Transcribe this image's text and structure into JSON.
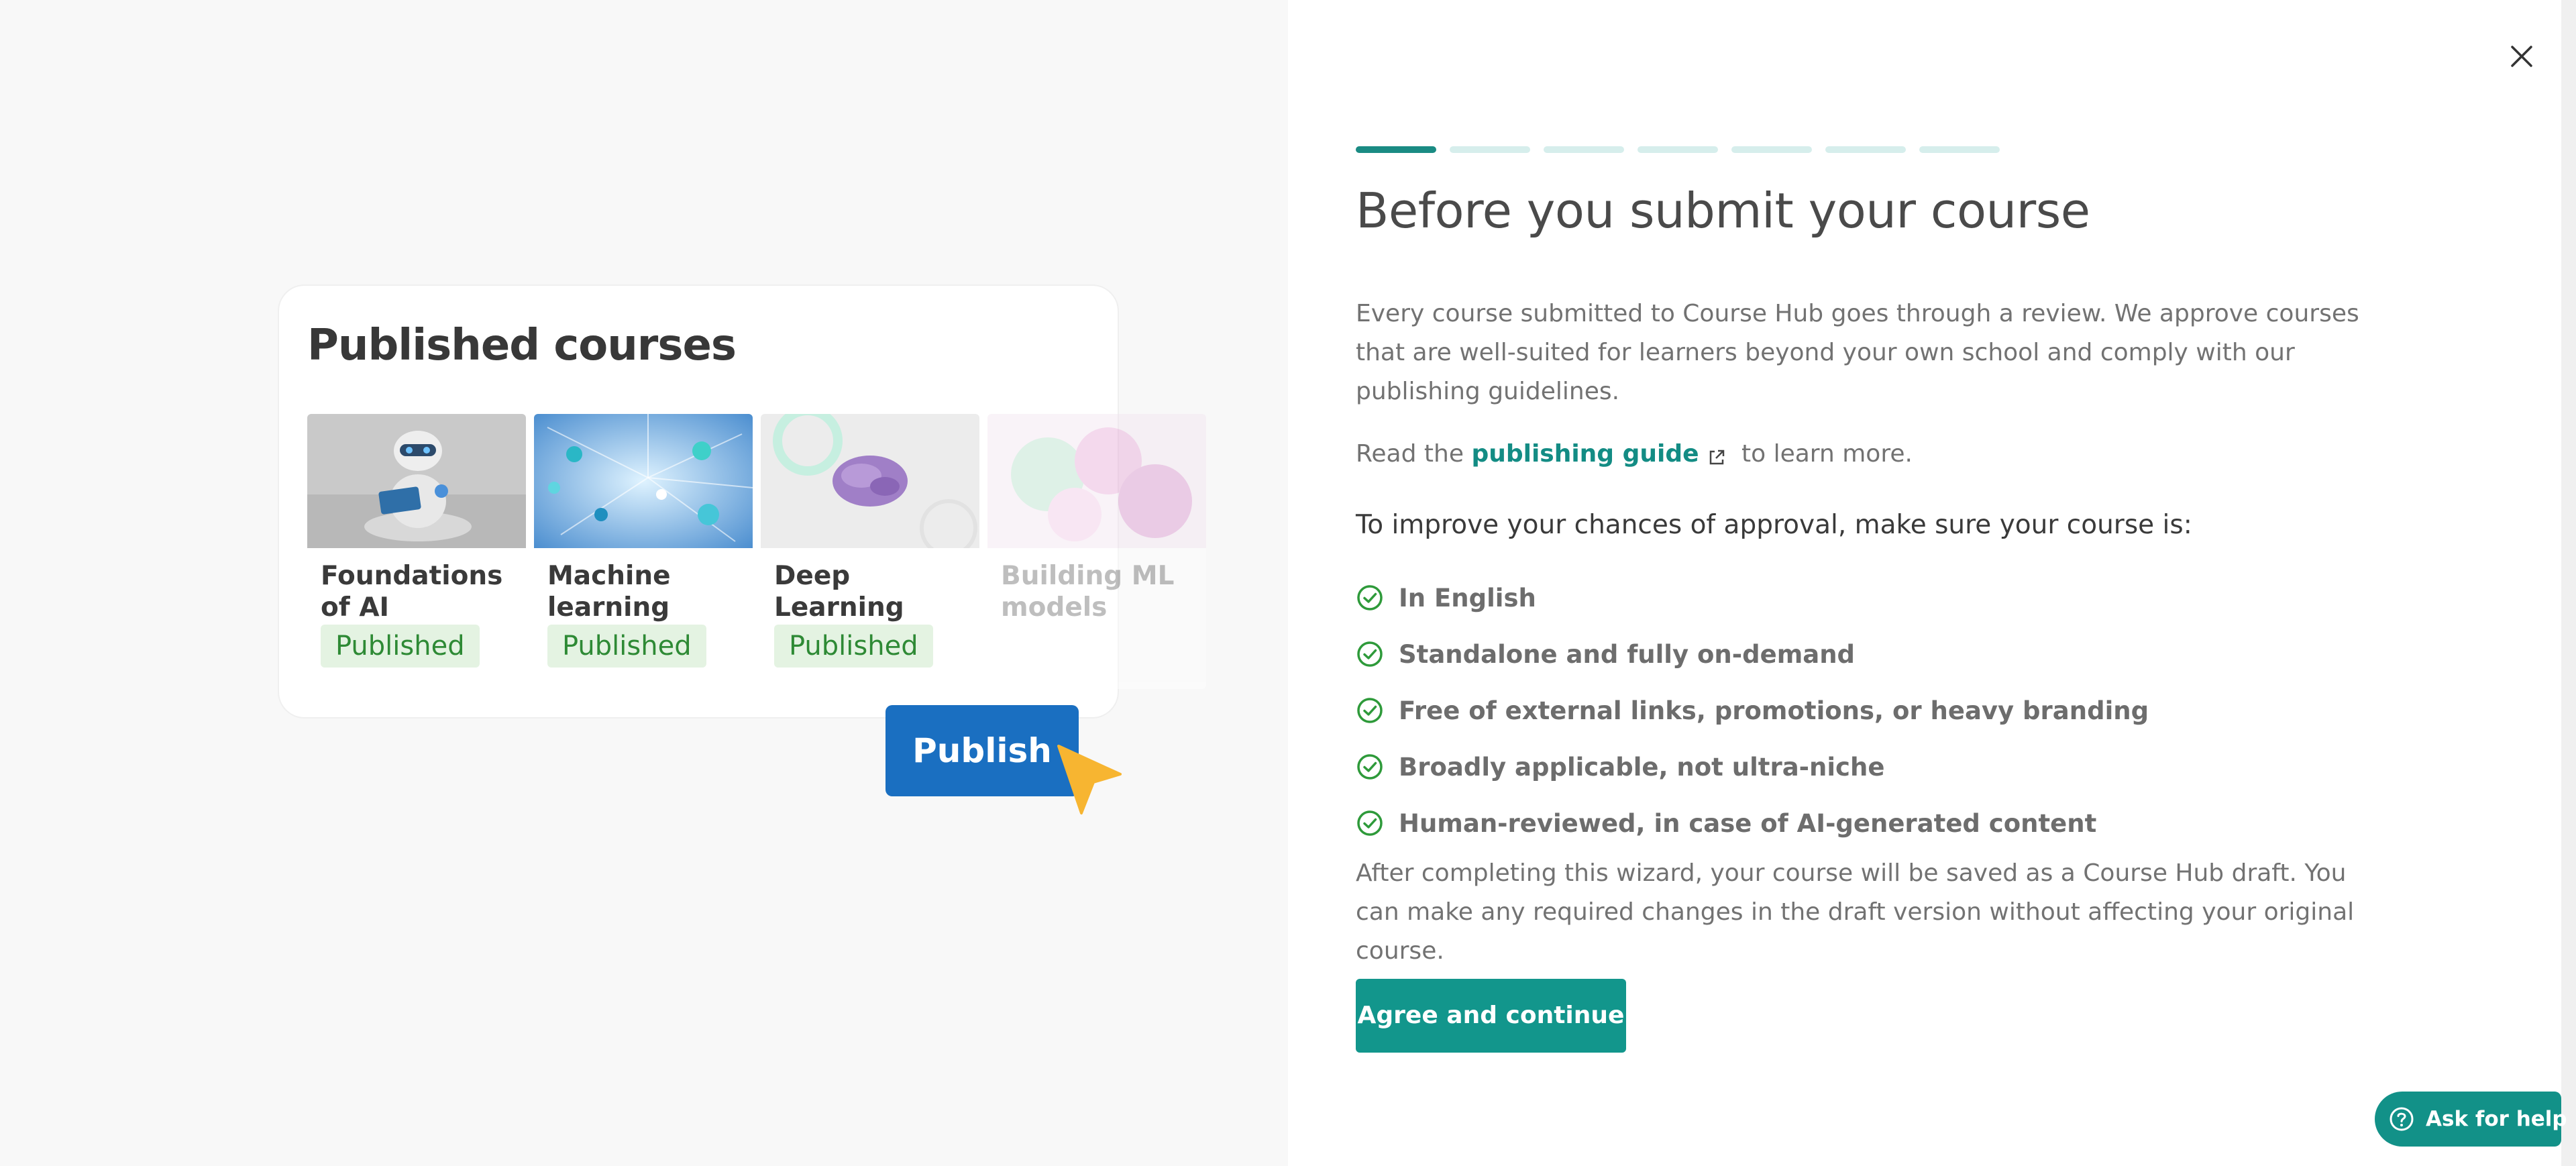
{
  "illustration": {
    "title": "Published courses",
    "courses": [
      {
        "name": "Foundations of AI",
        "status": "Published"
      },
      {
        "name": "Machine learning intro",
        "status": "Published"
      },
      {
        "name": "Deep Learning essentials",
        "status": "Published"
      },
      {
        "name": "Building ML models",
        "status": ""
      }
    ],
    "publish_label": "Publish"
  },
  "wizard": {
    "steps_total": 7,
    "current_step": 1,
    "heading": "Before you submit your course",
    "intro": "Every course submitted to Course Hub goes through a review. We approve courses that are well-suited for learners beyond your own school and comply with our publishing guidelines.",
    "read_prefix": "Read the",
    "guide_link": "publishing guide",
    "read_suffix": "to learn more.",
    "checklist_heading": "To improve your chances of approval, make sure your course is:",
    "checklist": [
      "In English",
      "Standalone and fully on-demand",
      "Free of external links, promotions, or heavy branding",
      "Broadly applicable, not ultra-niche",
      "Human-reviewed, in case of AI-generated content"
    ],
    "outro": "After completing this wizard, your course will be saved as a Course Hub draft. You can make any required changes in the draft version without affecting your original course.",
    "agree_label": "Agree and continue"
  },
  "help": {
    "label": "Ask for help"
  },
  "icons": {
    "close": "close-icon",
    "external": "external-link-icon",
    "check": "check-circle-icon",
    "help": "question-circle-icon",
    "cursor": "pointer-cursor-icon"
  },
  "colors": {
    "accent": "#12968c",
    "publish_blue": "#1a6fc1",
    "published_green": "#2e8a35",
    "cursor_yellow": "#f7b531"
  }
}
